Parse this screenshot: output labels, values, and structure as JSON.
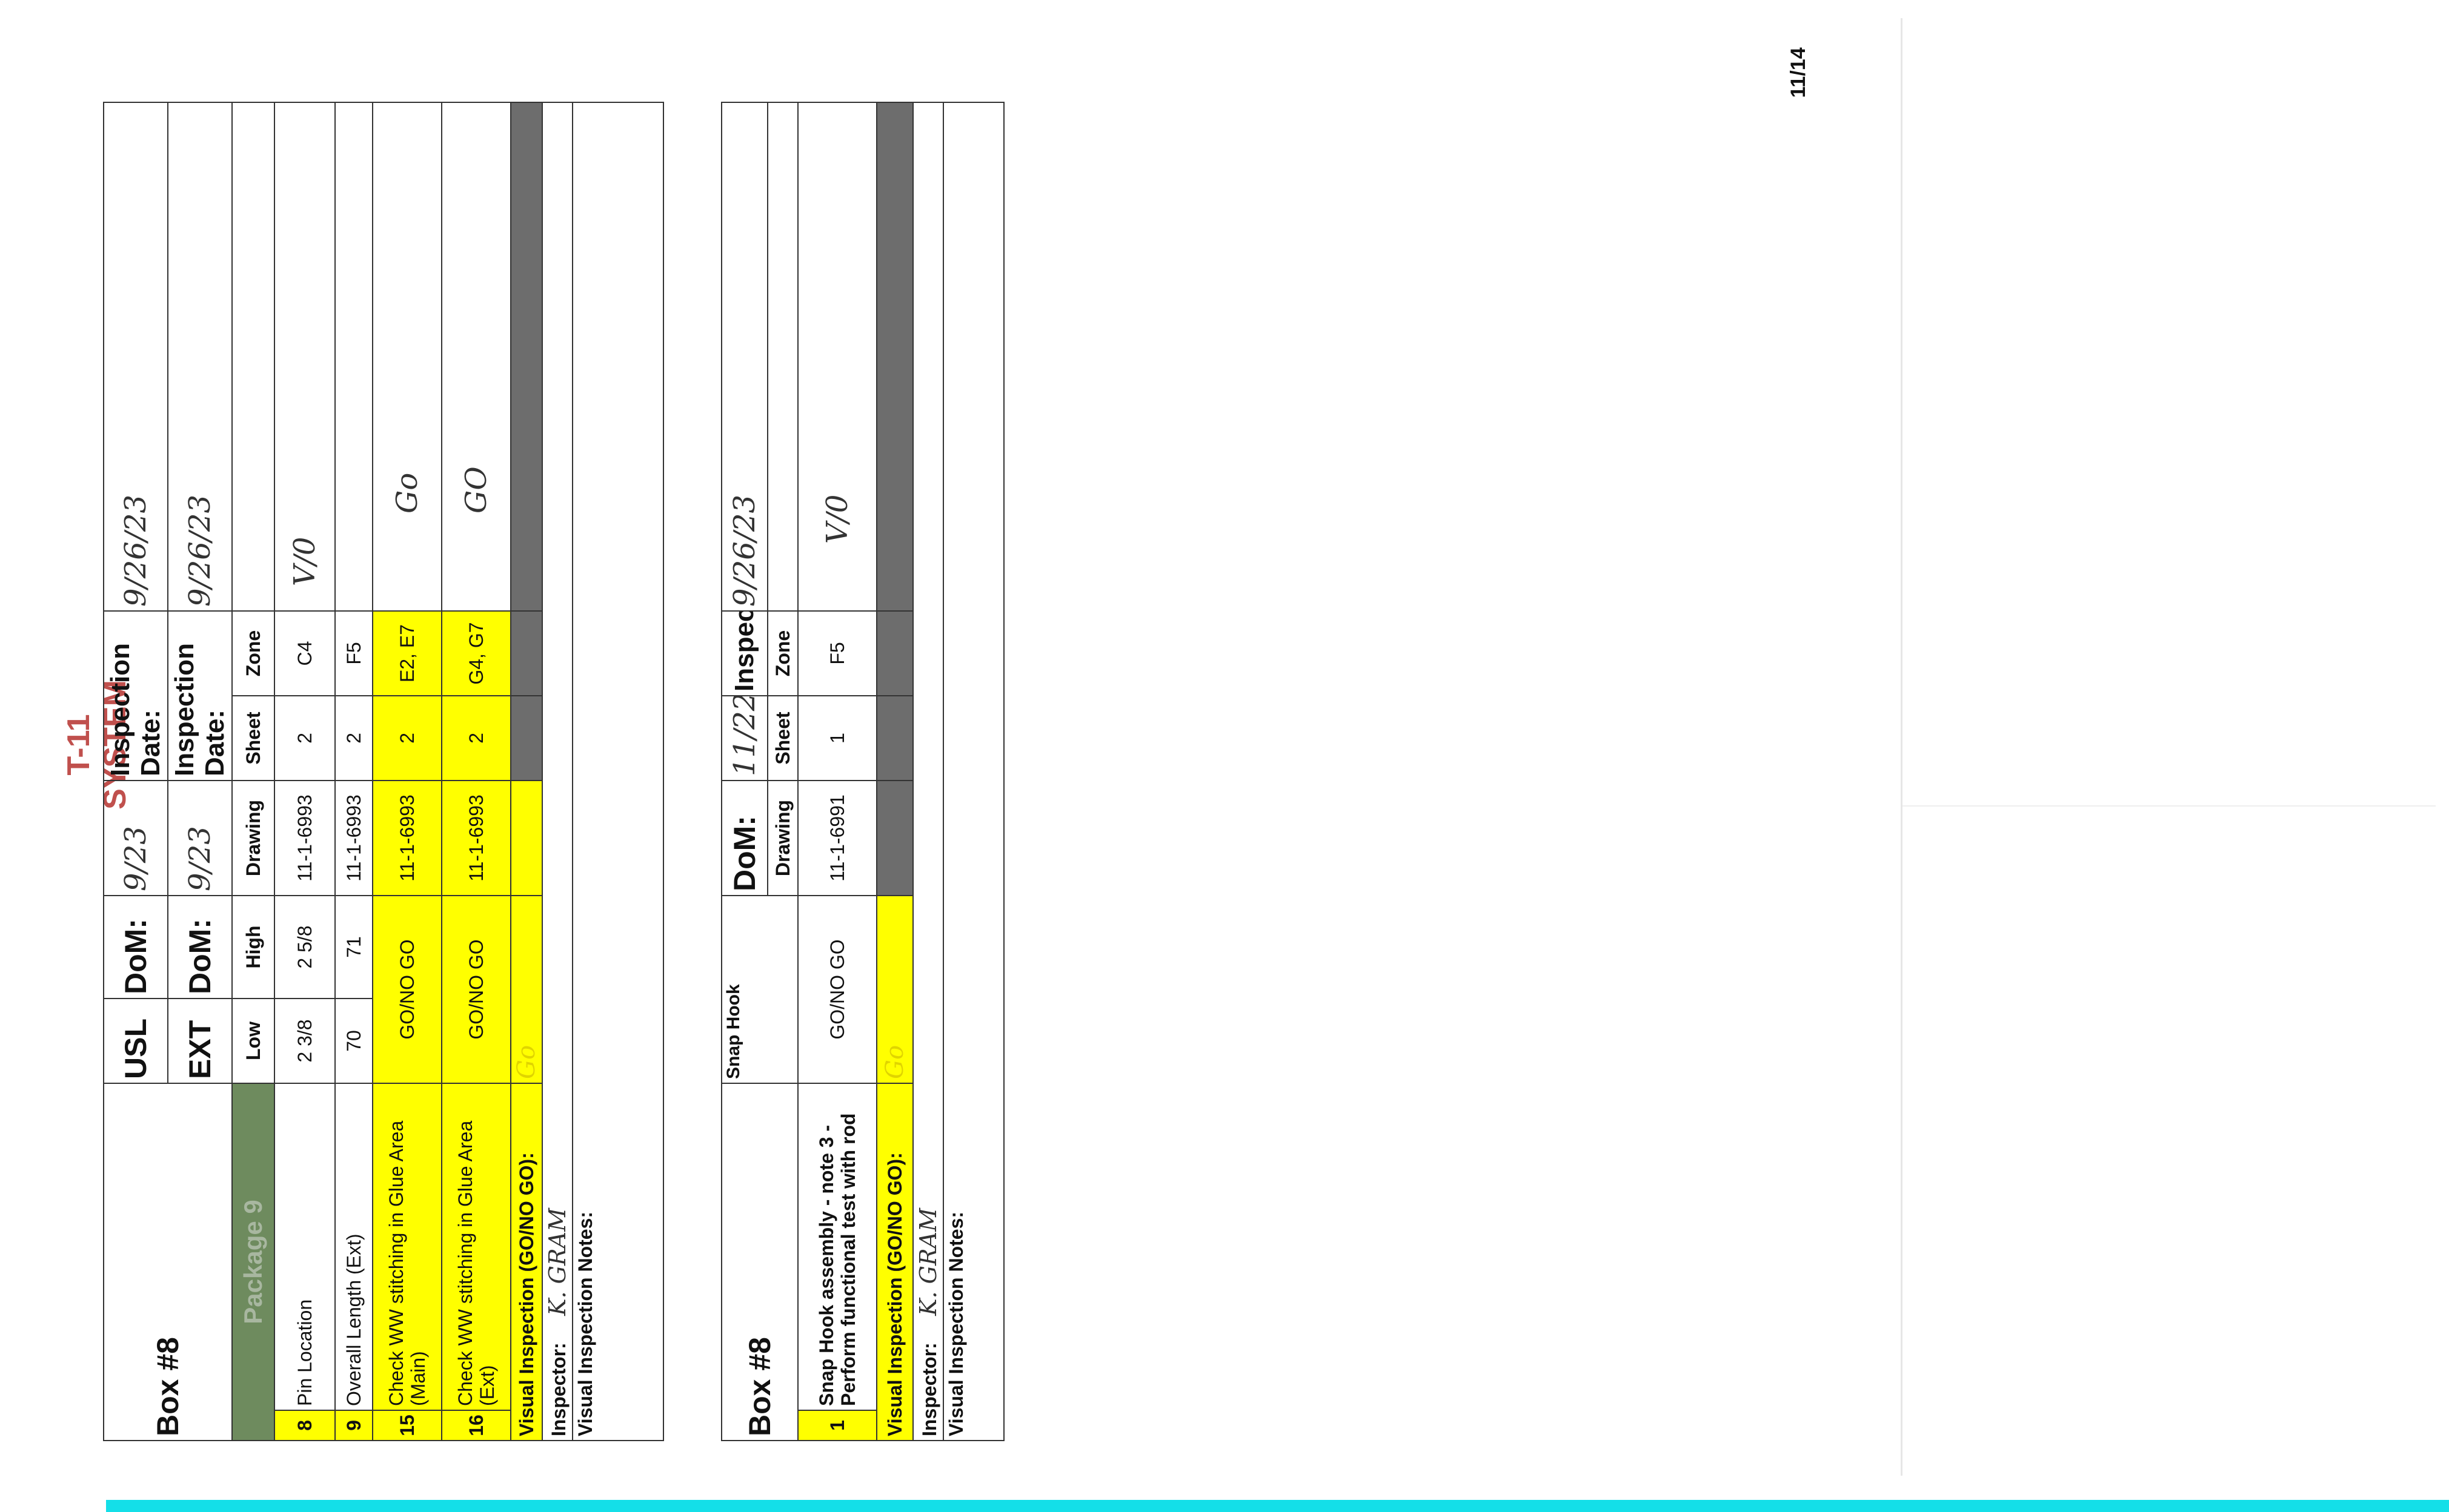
{
  "page_number": "11/14",
  "title": "T-11 SYSTEM",
  "table1": {
    "box_label": "Box #8",
    "usl_label": "USL",
    "ext_label": "EXT",
    "dom_label": "DoM:",
    "dom_usl": "9/23",
    "dom_ext": "9/23",
    "inspection_date_label": "Inspection Date:",
    "inspection_date_usl": "9/26/23",
    "inspection_date_ext": "9/26/23",
    "package_label": "Package 9",
    "headers": {
      "low": "Low",
      "high": "High",
      "drawing": "Drawing",
      "sheet": "Sheet",
      "zone": "Zone"
    },
    "rows": [
      {
        "num": "8",
        "desc": "Pin Location",
        "low": "2 3/8",
        "high": "2 5/8",
        "drawing": "11-1-6993",
        "sheet": "2",
        "zone": "C4",
        "result": "V/0"
      },
      {
        "num": "9",
        "desc": "Overall Length (Ext)",
        "low": "70",
        "high": "71",
        "drawing": "11-1-6993",
        "sheet": "2",
        "zone": "F5",
        "result": ""
      },
      {
        "num": "15",
        "desc": "Check WW stitching in Glue Area (Main)",
        "gonogo": "GO/NO GO",
        "drawing": "11-1-6993",
        "sheet": "2",
        "zone": "E2, E7",
        "result": "Go"
      },
      {
        "num": "16",
        "desc": "Check WW stitching in Glue Area (Ext)",
        "gonogo": "GO/NO GO",
        "drawing": "11-1-6993",
        "sheet": "2",
        "zone": "G4, G7",
        "result": "GO"
      }
    ],
    "visual_label": "Visual Inspection (GO/NO GO):",
    "visual_value": "Go",
    "inspector_label": "Inspector:",
    "inspector_value": "K. GRAM",
    "notes_label": "Visual Inspection Notes:"
  },
  "table2": {
    "box_label": "Box #8",
    "component": "Snap Hook",
    "dom_label": "DoM:",
    "dom_value": "11/22",
    "inspection_date_label": "Inspection Date:",
    "inspection_date_value": "9/26/23",
    "headers": {
      "drawing": "Drawing",
      "sheet": "Sheet",
      "zone": "Zone"
    },
    "rows": [
      {
        "num": "1",
        "desc": "Snap Hook assembly - note 3 - Perform functional test with rod",
        "gonogo": "GO/NO GO",
        "drawing": "11-1-6991",
        "sheet": "1",
        "zone": "F5",
        "result": "V/0"
      }
    ],
    "visual_label": "Visual Inspection (GO/NO GO):",
    "visual_value": "Go",
    "inspector_label": "Inspector:",
    "inspector_value": "K. GRAM",
    "notes_label": "Visual Inspection Notes:"
  }
}
